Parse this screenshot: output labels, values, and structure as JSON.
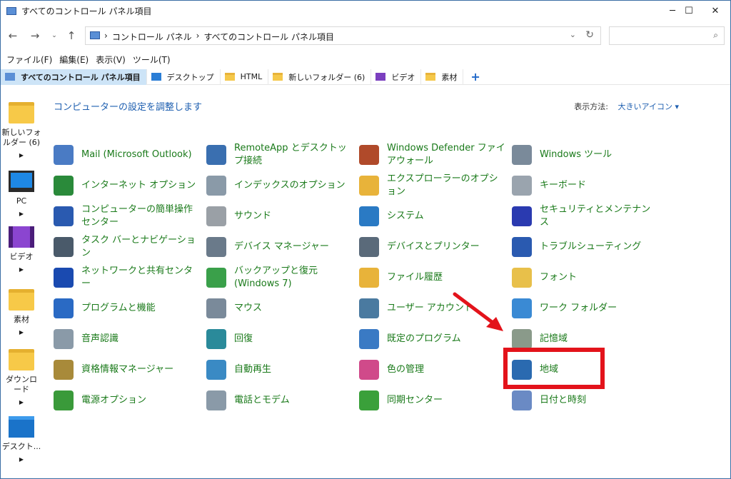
{
  "window": {
    "title": "すべてのコントロール パネル項目"
  },
  "address": {
    "crumbs": [
      "コントロール パネル",
      "すべてのコントロール パネル項目"
    ]
  },
  "menu": [
    "ファイル(F)",
    "編集(E)",
    "表示(V)",
    "ツール(T)"
  ],
  "tabs": [
    "すべてのコントロール パネル項目",
    "デスクトップ",
    "HTML",
    "新しいフォルダー (6)",
    "ビデオ",
    "素材"
  ],
  "sidebar": [
    {
      "label": "新しいフォルダー (6)",
      "icon": "folder-icon"
    },
    {
      "label": "PC",
      "icon": "pc-icon"
    },
    {
      "label": "ビデオ",
      "icon": "video-folder-icon"
    },
    {
      "label": "素材",
      "icon": "folder-icon"
    },
    {
      "label": "ダウンロード",
      "icon": "folder-icon"
    },
    {
      "label": "デスクト...",
      "icon": "desktop-icon"
    }
  ],
  "content": {
    "title": "コンピューターの設定を調整します",
    "view_by_label": "表示方法:",
    "view_by_value": "大きいアイコン"
  },
  "items": [
    [
      "Mail (Microsoft Outlook)",
      "RemoteApp とデスクトップ接続",
      "Windows Defender ファイアウォール",
      "Windows ツール"
    ],
    [
      "インターネット オプション",
      "インデックスのオプション",
      "エクスプローラーのオプション",
      "キーボード"
    ],
    [
      "コンピューターの簡単操作センター",
      "サウンド",
      "システム",
      "セキュリティとメンテナンス"
    ],
    [
      "タスク バーとナビゲーション",
      "デバイス マネージャー",
      "デバイスとプリンター",
      "トラブルシューティング"
    ],
    [
      "ネットワークと共有センター",
      "バックアップと復元 (Windows 7)",
      "ファイル履歴",
      "フォント"
    ],
    [
      "プログラムと機能",
      "マウス",
      "ユーザー アカウント",
      "ワーク フォルダー"
    ],
    [
      "音声認識",
      "回復",
      "既定のプログラム",
      "記憶域"
    ],
    [
      "資格情報マネージャー",
      "自動再生",
      "色の管理",
      "地域"
    ],
    [
      "電源オプション",
      "電話とモデム",
      "同期センター",
      "日付と時刻"
    ]
  ],
  "icon_colors": [
    [
      "#4a7bc4",
      "#3a6fb0",
      "#b04a2a",
      "#7a8a9a"
    ],
    [
      "#2a8a3a",
      "#8a9aa8",
      "#e8b33a",
      "#9aa4ae"
    ],
    [
      "#2a5ab0",
      "#9aa0a6",
      "#2a7ac4",
      "#2a3ab0"
    ],
    [
      "#4a5a6a",
      "#6a7a8a",
      "#5a6a7a",
      "#2a5ab0"
    ],
    [
      "#1a4ab0",
      "#3aa04a",
      "#e8b33a",
      "#e8c04a"
    ],
    [
      "#2a6ac4",
      "#7a8a9a",
      "#4a7aa0",
      "#3a8ad4"
    ],
    [
      "#8a9aa8",
      "#2a8a9a",
      "#3a7ac4",
      "#8a9a8a"
    ],
    [
      "#a88a3a",
      "#3a8ac4",
      "#d04a8a",
      "#2a6ab0"
    ],
    [
      "#3a9a3a",
      "#8a9aa8",
      "#3aa03a",
      "#6a8ac4"
    ]
  ],
  "annotation": {
    "highlight_target": "地域",
    "color": "#e3131b"
  }
}
